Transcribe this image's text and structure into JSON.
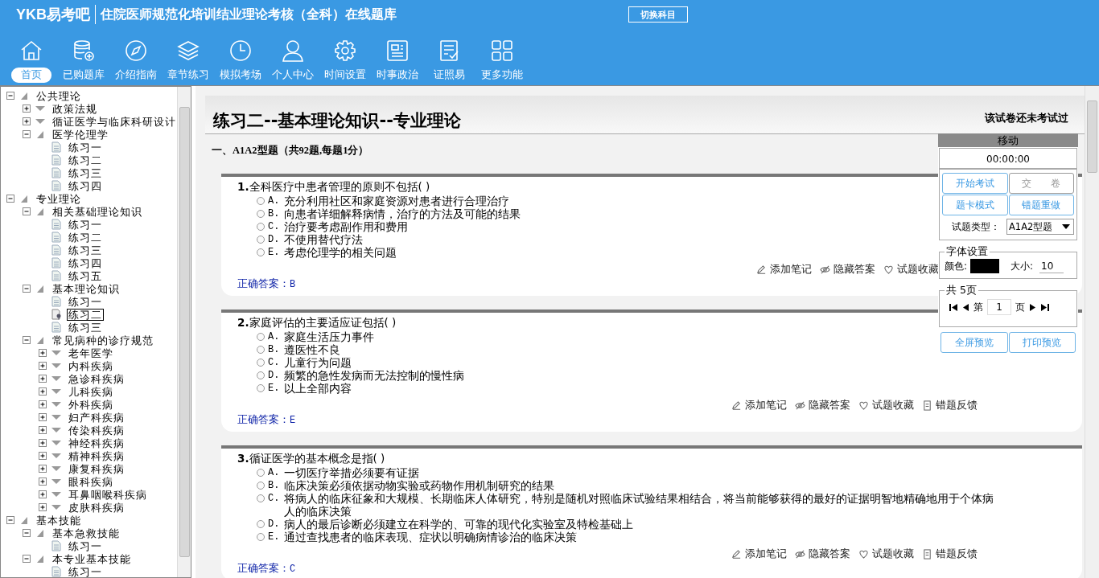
{
  "app": {
    "logo": "YKB易考吧",
    "title": "住院医师规范化培训结业理论考核（全科）在线题库",
    "switch_button": "切换科目"
  },
  "toolbar": [
    {
      "label": "首页",
      "selected": true
    },
    {
      "label": "已购题库",
      "selected": false
    },
    {
      "label": "介绍指南",
      "selected": false
    },
    {
      "label": "章节练习",
      "selected": false
    },
    {
      "label": "模拟考场",
      "selected": false
    },
    {
      "label": "个人中心",
      "selected": false
    },
    {
      "label": "时间设置",
      "selected": false
    },
    {
      "label": "时事政治",
      "selected": false
    },
    {
      "label": "证照易",
      "selected": false
    },
    {
      "label": "更多功能",
      "selected": false
    }
  ],
  "tree": [
    {
      "label": "公共理论",
      "kind": "folder",
      "expanded": true,
      "selected": false,
      "children": [
        {
          "label": "政策法规",
          "kind": "folder",
          "expanded": false,
          "selected": false
        },
        {
          "label": "循证医学与临床科研设计",
          "kind": "folder",
          "expanded": false,
          "selected": false
        },
        {
          "label": "医学伦理学",
          "kind": "folder",
          "expanded": true,
          "selected": false,
          "children": [
            {
              "label": "练习一",
              "kind": "leaf",
              "selected": false
            },
            {
              "label": "练习二",
              "kind": "leaf",
              "selected": false
            },
            {
              "label": "练习三",
              "kind": "leaf",
              "selected": false
            },
            {
              "label": "练习四",
              "kind": "leaf",
              "selected": false
            }
          ]
        }
      ]
    },
    {
      "label": "专业理论",
      "kind": "folder",
      "expanded": true,
      "selected": false,
      "children": [
        {
          "label": "相关基础理论知识",
          "kind": "folder",
          "expanded": true,
          "selected": false,
          "children": [
            {
              "label": "练习一",
              "kind": "leaf",
              "selected": false
            },
            {
              "label": "练习二",
              "kind": "leaf",
              "selected": false
            },
            {
              "label": "练习三",
              "kind": "leaf",
              "selected": false
            },
            {
              "label": "练习四",
              "kind": "leaf",
              "selected": false
            },
            {
              "label": "练习五",
              "kind": "leaf",
              "selected": false
            }
          ]
        },
        {
          "label": "基本理论知识",
          "kind": "folder",
          "expanded": true,
          "selected": false,
          "children": [
            {
              "label": "练习一",
              "kind": "leaf",
              "selected": false
            },
            {
              "label": "练习二",
              "kind": "leaf",
              "selected": true
            },
            {
              "label": "练习三",
              "kind": "leaf",
              "selected": false
            }
          ]
        },
        {
          "label": "常见病种的诊疗规范",
          "kind": "folder",
          "expanded": true,
          "selected": false,
          "children": [
            {
              "label": "老年医学",
              "kind": "folder",
              "expanded": false,
              "selected": false
            },
            {
              "label": "内科疾病",
              "kind": "folder",
              "expanded": false,
              "selected": false
            },
            {
              "label": "急诊科疾病",
              "kind": "folder",
              "expanded": false,
              "selected": false
            },
            {
              "label": "儿科疾病",
              "kind": "folder",
              "expanded": false,
              "selected": false
            },
            {
              "label": "外科疾病",
              "kind": "folder",
              "expanded": false,
              "selected": false
            },
            {
              "label": "妇产科疾病",
              "kind": "folder",
              "expanded": false,
              "selected": false
            },
            {
              "label": "传染科疾病",
              "kind": "folder",
              "expanded": false,
              "selected": false
            },
            {
              "label": "神经科疾病",
              "kind": "folder",
              "expanded": false,
              "selected": false
            },
            {
              "label": "精神科疾病",
              "kind": "folder",
              "expanded": false,
              "selected": false
            },
            {
              "label": "康复科疾病",
              "kind": "folder",
              "expanded": false,
              "selected": false
            },
            {
              "label": "眼科疾病",
              "kind": "folder",
              "expanded": false,
              "selected": false
            },
            {
              "label": "耳鼻咽喉科疾病",
              "kind": "folder",
              "expanded": false,
              "selected": false
            },
            {
              "label": "皮肤科疾病",
              "kind": "folder",
              "expanded": false,
              "selected": false
            }
          ]
        }
      ]
    },
    {
      "label": "基本技能",
      "kind": "folder",
      "expanded": true,
      "selected": false,
      "children": [
        {
          "label": "基本急救技能",
          "kind": "folder",
          "expanded": true,
          "selected": false,
          "children": [
            {
              "label": "练习一",
              "kind": "leaf",
              "selected": false
            }
          ]
        },
        {
          "label": "本专业基本技能",
          "kind": "folder",
          "expanded": true,
          "selected": false,
          "children": [
            {
              "label": "练习一",
              "kind": "leaf",
              "selected": false
            }
          ]
        }
      ]
    }
  ],
  "exam": {
    "title": "练习二--基本理论知识--专业理论",
    "status": "该试卷还未考试过",
    "section": "一、A1A2型题（共92题,每题1分）",
    "questions": [
      {
        "number": "1.",
        "text": "全科医疗中患者管理的原则不包括( )",
        "options": [
          {
            "letter": "A.",
            "text": "充分利用社区和家庭资源对患者进行合理治疗",
            "selected": false
          },
          {
            "letter": "B.",
            "text": "向患者详细解释病情，治疗的方法及可能的结果",
            "selected": false
          },
          {
            "letter": "C.",
            "text": "治疗要考虑副作用和费用",
            "selected": false
          },
          {
            "letter": "D.",
            "text": "不使用替代疗法",
            "selected": false
          },
          {
            "letter": "E.",
            "text": "考虑伦理学的相关问题",
            "selected": false
          }
        ],
        "actions": [
          "添加笔记",
          "隐藏答案",
          "试题收藏"
        ],
        "answer_label": "正确答案：",
        "answer": "B"
      },
      {
        "number": "2.",
        "text": "家庭评估的主要适应证包括( )",
        "options": [
          {
            "letter": "A.",
            "text": "家庭生活压力事件",
            "selected": false
          },
          {
            "letter": "B.",
            "text": "遵医性不良",
            "selected": false
          },
          {
            "letter": "C.",
            "text": "儿童行为问题",
            "selected": false
          },
          {
            "letter": "D.",
            "text": "频繁的急性发病而无法控制的慢性病",
            "selected": false
          },
          {
            "letter": "E.",
            "text": "以上全部内容",
            "selected": false
          }
        ],
        "actions": [
          "添加笔记",
          "隐藏答案",
          "试题收藏",
          "错题反馈"
        ],
        "answer_label": "正确答案：",
        "answer": "E"
      },
      {
        "number": "3.",
        "text": "循证医学的基本概念是指( )",
        "options": [
          {
            "letter": "A.",
            "text": "一切医疗举措必须要有证据",
            "selected": false
          },
          {
            "letter": "B.",
            "text": "临床决策必须依据动物实验或药物作用机制研究的结果",
            "selected": false
          },
          {
            "letter": "C.",
            "text": "将病人的临床征象和大规模、长期临床人体研究，特别是随机对照临床试验结果相结合，将当前能够获得的最好的证据明智地精确地用于个体病人的临床决策",
            "selected": false
          },
          {
            "letter": "D.",
            "text": "病人的最后诊断必须建立在科学的、可靠的现代化实验室及特检基础上",
            "selected": false
          },
          {
            "letter": "E.",
            "text": "通过查找患者的临床表现、症状以明确病情诊治的临床决策",
            "selected": false
          }
        ],
        "actions": [
          "添加笔记",
          "隐藏答案",
          "试题收藏",
          "错题反馈"
        ],
        "answer_label": "正确答案：",
        "answer": "C"
      }
    ]
  },
  "panel": {
    "title": "移动",
    "timer": "00:00:00",
    "buttons": [
      {
        "label": "开始考试",
        "disabled": false
      },
      {
        "label": "交　　卷",
        "disabled": true
      },
      {
        "label": "题卡模式",
        "disabled": false
      },
      {
        "label": "错题重做",
        "disabled": false
      }
    ],
    "type_label": "试题类型：",
    "type_value": "A1A2型题",
    "font": {
      "legend": "字体设置",
      "color_label": "颜色:",
      "color": "#000000",
      "size_label": "大小:",
      "size": "10"
    },
    "pager": {
      "legend": "共 5页",
      "before": "第",
      "page": "1",
      "after": "页"
    },
    "bottom_buttons": [
      "全屏预览",
      "打印预览"
    ]
  }
}
